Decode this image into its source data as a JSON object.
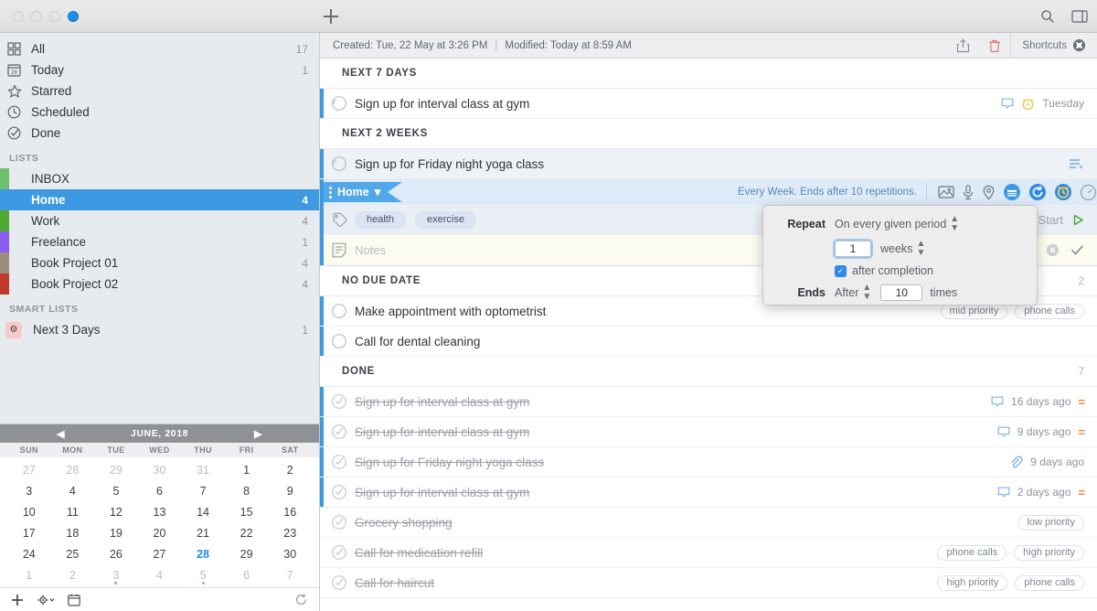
{
  "titlebar": {
    "add_label": "+",
    "search_icon": "search-icon",
    "panel_icon": "sidebar-toggle-icon"
  },
  "sidebar": {
    "smart_rows": [
      {
        "label": "All",
        "count": "17",
        "icon": "grid-icon"
      },
      {
        "label": "Today",
        "count": "1",
        "icon": "calendar-28-icon"
      },
      {
        "label": "Starred",
        "count": "",
        "icon": "star-icon"
      },
      {
        "label": "Scheduled",
        "count": "",
        "icon": "clock-icon"
      },
      {
        "label": "Done",
        "count": "",
        "icon": "check-circle-icon"
      }
    ],
    "lists_header": "LISTS",
    "lists": [
      {
        "label": "INBOX",
        "count": "",
        "color": "#6cc16c",
        "selected": false
      },
      {
        "label": "Home",
        "count": "4",
        "color": "#3d9ae2",
        "selected": true
      },
      {
        "label": "Work",
        "count": "4",
        "color": "#4fa832",
        "selected": false
      },
      {
        "label": "Freelance",
        "count": "1",
        "color": "#8b5cf0",
        "selected": false
      },
      {
        "label": "Book Project 01",
        "count": "4",
        "color": "#9b8f79",
        "selected": false
      },
      {
        "label": "Book Project 02",
        "count": "4",
        "color": "#c0392b",
        "selected": false
      }
    ],
    "smart_header": "SMART LISTS",
    "smart_lists": [
      {
        "label": "Next 3 Days",
        "count": "1",
        "icon": "gear-badge-icon"
      }
    ]
  },
  "calendar": {
    "title": "JUNE, 2018",
    "prev": "◀",
    "next": "▶",
    "dows": [
      "SUN",
      "MON",
      "TUE",
      "WED",
      "THU",
      "FRI",
      "SAT"
    ],
    "weeks": [
      [
        {
          "d": "27",
          "mute": true
        },
        {
          "d": "28",
          "mute": true
        },
        {
          "d": "29",
          "mute": true
        },
        {
          "d": "30",
          "mute": true
        },
        {
          "d": "31",
          "mute": true
        },
        {
          "d": "1"
        },
        {
          "d": "2"
        }
      ],
      [
        {
          "d": "3"
        },
        {
          "d": "4"
        },
        {
          "d": "5"
        },
        {
          "d": "6"
        },
        {
          "d": "7"
        },
        {
          "d": "8"
        },
        {
          "d": "9"
        }
      ],
      [
        {
          "d": "10"
        },
        {
          "d": "11"
        },
        {
          "d": "12"
        },
        {
          "d": "13"
        },
        {
          "d": "14"
        },
        {
          "d": "15"
        },
        {
          "d": "16"
        }
      ],
      [
        {
          "d": "17"
        },
        {
          "d": "18"
        },
        {
          "d": "19"
        },
        {
          "d": "20"
        },
        {
          "d": "21"
        },
        {
          "d": "22"
        },
        {
          "d": "23"
        }
      ],
      [
        {
          "d": "24"
        },
        {
          "d": "25"
        },
        {
          "d": "26"
        },
        {
          "d": "27"
        },
        {
          "d": "28",
          "today": true
        },
        {
          "d": "29"
        },
        {
          "d": "30"
        }
      ],
      [
        {
          "d": "1",
          "mute": true
        },
        {
          "d": "2",
          "mute": true
        },
        {
          "d": "3",
          "mute": true,
          "dot": true
        },
        {
          "d": "4",
          "mute": true
        },
        {
          "d": "5",
          "mute": true,
          "dot": true
        },
        {
          "d": "6",
          "mute": true
        },
        {
          "d": "7",
          "mute": true
        }
      ]
    ],
    "footer": {
      "add": "+",
      "gear": "gear-icon",
      "calendar": "calendar-icon",
      "refresh": "refresh-icon"
    }
  },
  "meta": {
    "created": "Created: Tue, 22 May at 3:26 PM",
    "separator": "|",
    "modified": "Modified: Today at 8:59 AM",
    "share_icon": "share-icon",
    "trash_icon": "trash-icon",
    "shortcuts_label": "Shortcuts",
    "shortcuts_icon": "shortcuts-badge-icon"
  },
  "sections": [
    {
      "title": "NEXT 7 DAYS",
      "count": "",
      "tasks": [
        {
          "title": "Sign up for interval class at gym",
          "state": "repeat",
          "accent": true,
          "badges": [
            "comment-icon",
            "alarm-icon"
          ],
          "due": "Tuesday",
          "priority": "",
          "tags": []
        }
      ]
    },
    {
      "title": "NEXT 2 WEEKS",
      "count": "",
      "tasks": [
        {
          "title": "Sign up for Friday night yoga class",
          "state": "repeat",
          "accent": true,
          "selected": true,
          "badges": [
            "subtasks-icon"
          ],
          "due": "",
          "priority": "",
          "tags": []
        }
      ]
    },
    {
      "title": "NO DUE DATE",
      "count": "2",
      "tasks": [
        {
          "title": "Make appointment with optometrist",
          "state": "open",
          "accent": true,
          "badges": [],
          "due": "",
          "priority": "",
          "tags": [
            "mid priority",
            "phone calls"
          ]
        },
        {
          "title": "Call for dental cleaning",
          "state": "open",
          "accent": true,
          "badges": [],
          "due": "",
          "priority": "",
          "tags": []
        }
      ]
    },
    {
      "title": "DONE",
      "count": "7",
      "tasks": [
        {
          "title": "Sign up for interval class at gym",
          "state": "done",
          "accent": true,
          "badges": [
            "comment-icon"
          ],
          "due": "16 days ago",
          "priority": "=",
          "tags": []
        },
        {
          "title": "Sign up for interval class at gym",
          "state": "done",
          "accent": true,
          "badges": [
            "comment-icon"
          ],
          "due": "9 days ago",
          "priority": "=",
          "tags": []
        },
        {
          "title": "Sign up for Friday night yoga class",
          "state": "done",
          "accent": true,
          "badges": [
            "attachment-icon"
          ],
          "due": "9 days ago",
          "priority": "",
          "tags": []
        },
        {
          "title": "Sign up for interval class at gym",
          "state": "done",
          "accent": true,
          "badges": [
            "comment-icon"
          ],
          "due": "2 days ago",
          "priority": "=",
          "tags": []
        },
        {
          "title": "Grocery shopping",
          "state": "done",
          "accent": false,
          "badges": [],
          "due": "",
          "priority": "",
          "tags": [
            "low priority"
          ]
        },
        {
          "title": "Call for medication refill",
          "state": "done",
          "accent": false,
          "badges": [],
          "due": "",
          "priority": "",
          "tags": [
            "phone calls",
            "high priority"
          ]
        },
        {
          "title": "Call for haircut",
          "state": "done",
          "accent": false,
          "badges": [],
          "due": "",
          "priority": "",
          "tags": [
            "high priority",
            "phone calls"
          ]
        }
      ]
    }
  ],
  "detail": {
    "list_tag": "Home",
    "list_tag_chevron": "⌄",
    "repeat_summary": "Every Week. Ends after 10 repetitions.",
    "toolbar_icons": [
      "image-icon",
      "microphone-icon",
      "location-icon",
      "calendar-icon",
      "repeat-icon",
      "alarm-icon",
      "timer-icon"
    ],
    "tags": [
      "health",
      "exercise"
    ],
    "notes_placeholder": "Notes",
    "start_label": "Start",
    "cancel_icon": "cancel-icon",
    "confirm_icon": "confirm-icon"
  },
  "popover": {
    "repeat_label": "Repeat",
    "repeat_mode": "On every given period",
    "interval_value": "1",
    "interval_unit": "weeks",
    "after_completion": "after completion",
    "ends_label": "Ends",
    "ends_mode": "After",
    "ends_count": "10",
    "ends_unit": "times"
  },
  "colors": {
    "accent": "#3d9ae2",
    "selected_list": "#3d9ae2",
    "priority": "#f0862f",
    "today": "#1a8cf0"
  }
}
